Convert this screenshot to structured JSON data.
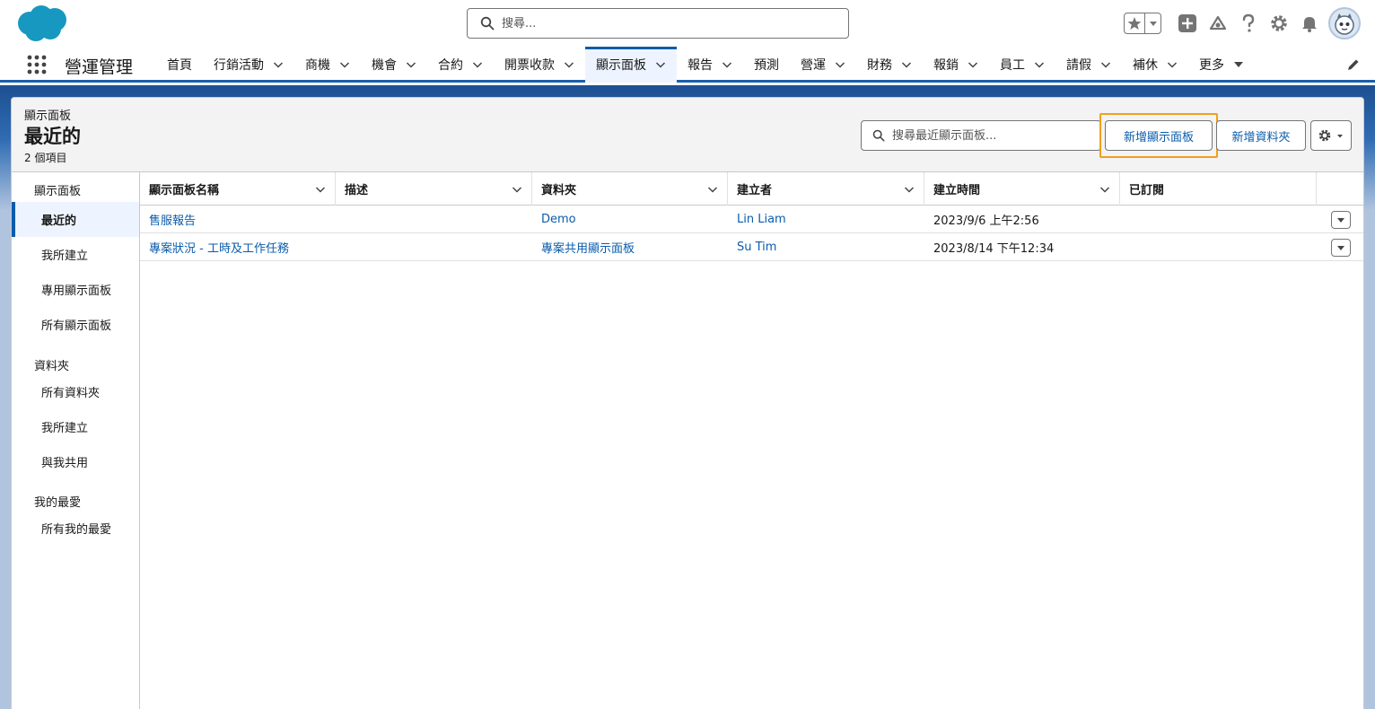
{
  "global_header": {
    "search_placeholder": "搜尋..."
  },
  "nav": {
    "app_name": "營運管理",
    "items": [
      {
        "label": "首頁",
        "has_menu": false
      },
      {
        "label": "行銷活動",
        "has_menu": true
      },
      {
        "label": "商機",
        "has_menu": true
      },
      {
        "label": "機會",
        "has_menu": true
      },
      {
        "label": "合約",
        "has_menu": true
      },
      {
        "label": "開票收款",
        "has_menu": true
      },
      {
        "label": "顯示面板",
        "has_menu": true,
        "active": true
      },
      {
        "label": "報告",
        "has_menu": true
      },
      {
        "label": "預測",
        "has_menu": false
      },
      {
        "label": "營運",
        "has_menu": true
      },
      {
        "label": "財務",
        "has_menu": true
      },
      {
        "label": "報銷",
        "has_menu": true
      },
      {
        "label": "員工",
        "has_menu": true
      },
      {
        "label": "請假",
        "has_menu": true
      },
      {
        "label": "補休",
        "has_menu": true
      },
      {
        "label": "更多",
        "has_menu": true
      }
    ]
  },
  "page_header": {
    "object_label": "顯示面板",
    "title": "最近的",
    "item_count": "2 個項目",
    "search_placeholder": "搜尋最近顯示面板...",
    "new_dashboard_label": "新增顯示面板",
    "new_folder_label": "新增資料夾"
  },
  "sidebar": {
    "dashboards_section": "顯示面板",
    "dashboards_items": [
      "最近的",
      "我所建立",
      "專用顯示面板",
      "所有顯示面板"
    ],
    "folders_section": "資料夾",
    "folders_items": [
      "所有資料夾",
      "我所建立",
      "與我共用"
    ],
    "favorites_section": "我的最愛",
    "favorites_items": [
      "所有我的最愛"
    ]
  },
  "table": {
    "columns": [
      "顯示面板名稱",
      "描述",
      "資料夾",
      "建立者",
      "建立時間",
      "已訂閱"
    ],
    "rows": [
      {
        "name": "售服報告",
        "description": "",
        "folder": "Demo",
        "creator": "Lin Liam",
        "created": "2023/9/6 上午2:56",
        "subscribed": ""
      },
      {
        "name": "專案狀況 - 工時及工作任務",
        "description": "",
        "folder": "專案共用顯示面板",
        "creator": "Su Tim",
        "created": "2023/8/14 下午12:34",
        "subscribed": ""
      }
    ]
  },
  "colors": {
    "brand_blue": "#0b5cab",
    "highlight_orange": "#f0a020",
    "nav_accent": "#1b5fad"
  }
}
